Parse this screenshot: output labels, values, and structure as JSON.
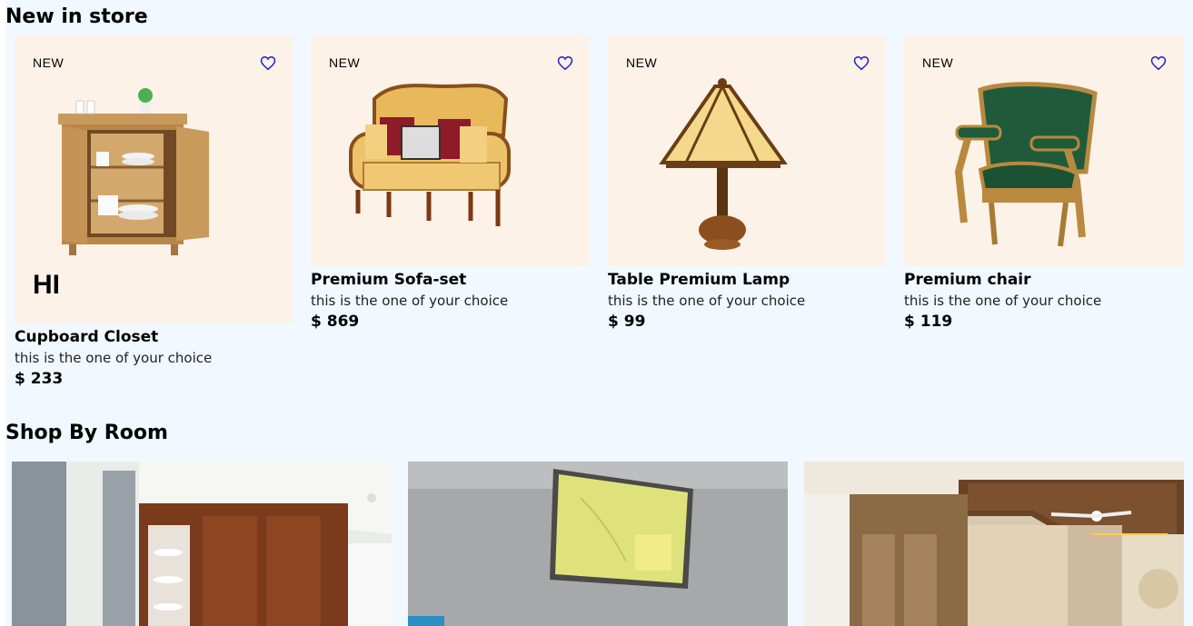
{
  "sections": {
    "new_in_store": "New in store",
    "shop_by_room": "Shop By Room"
  },
  "products": [
    {
      "badge": "NEW",
      "name": "Cupboard Closet",
      "desc": "this is the one of your choice",
      "price": "$ 233",
      "overlay": "HI"
    },
    {
      "badge": "NEW",
      "name": "Premium Sofa-set",
      "desc": "this is the one of your choice",
      "price": "$ 869"
    },
    {
      "badge": "NEW",
      "name": "Table Premium Lamp",
      "desc": "this is the one of your choice",
      "price": "$ 99"
    },
    {
      "badge": "NEW",
      "name": "Premium chair",
      "desc": "this is the one of your choice",
      "price": "$ 119"
    }
  ],
  "icons": {
    "wishlist": "heart-outline-icon"
  },
  "colors": {
    "page_bg": "#f1f8ff",
    "card_bg": "#fdf2e8",
    "heart": "#2222cc"
  }
}
